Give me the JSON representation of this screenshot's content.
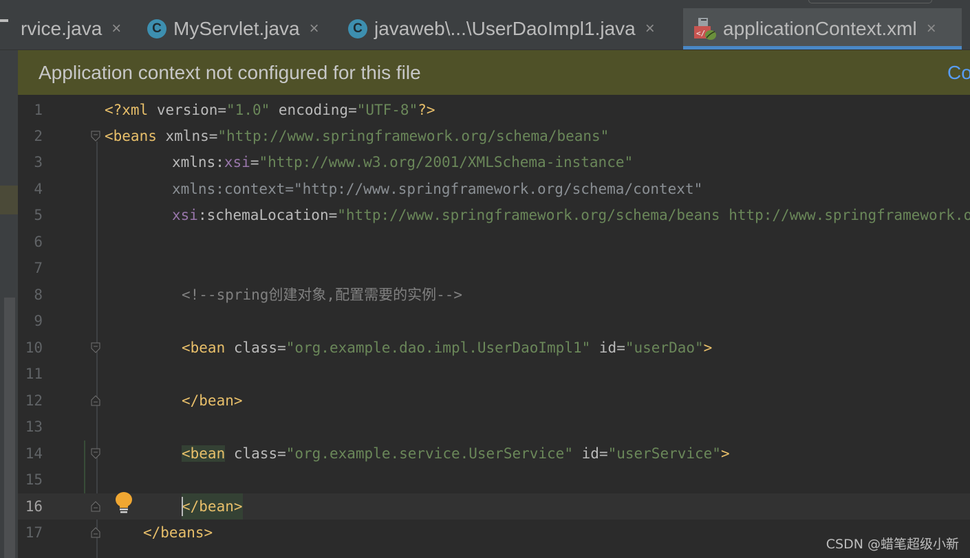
{
  "tabs": [
    {
      "label": "rvice.java",
      "icon": "none",
      "active": false
    },
    {
      "label": "MyServlet.java",
      "icon": "java-class-icon",
      "active": false
    },
    {
      "label": "javaweb\\...\\UserDaoImpl1.java",
      "icon": "java-class-icon",
      "active": false
    },
    {
      "label": "applicationContext.xml",
      "icon": "spring-xml-icon",
      "active": true
    }
  ],
  "close_glyph": "×",
  "class_icon_letter": "C",
  "banner": {
    "message": "Application context not configured for this file",
    "action": "Co"
  },
  "editor": {
    "line_numbers": [
      "1",
      "2",
      "3",
      "4",
      "5",
      "6",
      "7",
      "8",
      "9",
      "10",
      "11",
      "12",
      "13",
      "14",
      "15",
      "16",
      "17"
    ],
    "current_line": 16,
    "lines": {
      "l1": [
        "<?xml ",
        "version",
        "=",
        "\"1.0\"",
        " ",
        "encoding",
        "=",
        "\"UTF-8\"",
        "?>"
      ],
      "l2": [
        "<beans ",
        "xmlns",
        "=",
        "\"http://www.springframework.org/schema/beans\""
      ],
      "l3": [
        "xmlns",
        ":",
        "xsi",
        "=",
        "\"http://www.w3.org/2001/XMLSchema-instance\""
      ],
      "l4": [
        "xmlns:context=\"http://www.springframework.org/schema/context\""
      ],
      "l5": [
        "xsi",
        ":",
        "schemaLocation",
        "=",
        "\"http://www.springframework.org/schema/beans http://www.springframework.org/schema/beans/spring-beans.xsd\""
      ],
      "l8": [
        "<!--spring创建对象,配置需要的实例-->"
      ],
      "l10": [
        "<bean ",
        "class",
        "=",
        "\"org.example.dao.impl.UserDaoImpl1\"",
        " ",
        "id",
        "=",
        "\"userDao\"",
        ">"
      ],
      "l12": [
        "</bean>"
      ],
      "l14": [
        "<bean",
        " ",
        "class",
        "=",
        "\"org.example.service.UserService\"",
        " ",
        "id",
        "=",
        "\"userService\"",
        ">"
      ],
      "l16": [
        "</bean>"
      ],
      "l17": [
        "</beans>"
      ]
    }
  },
  "watermark": "CSDN @蜡笔超级小新",
  "colors": {
    "tag": "#e8bf6a",
    "attribute": "#bababa",
    "namespace": "#9876aa",
    "value": "#6a8759",
    "comment": "#808080",
    "banner_bg": "#4f5128",
    "link": "#589df6"
  }
}
